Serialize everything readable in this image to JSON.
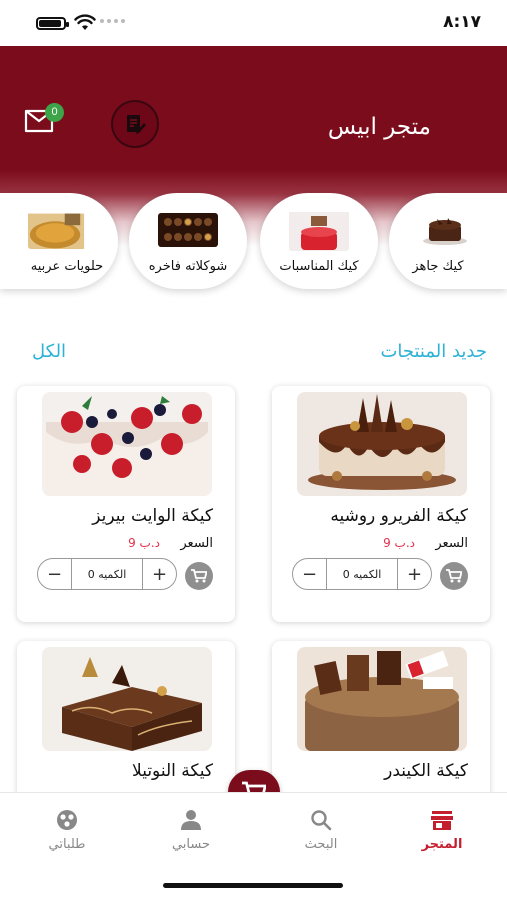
{
  "status_bar": {
    "time": "٨:١٧"
  },
  "header": {
    "store_title": "متجر ابيس",
    "cart_count": "0"
  },
  "categories": [
    {
      "label": "كيك جاهز"
    },
    {
      "label": "كيك المناسبات"
    },
    {
      "label": "شوكلاته فاخره"
    },
    {
      "label": "حلويات عربيه"
    }
  ],
  "section": {
    "title": "جديد المنتجات",
    "see_all": "الكل"
  },
  "products": [
    {
      "name": "كيكة الفريرو روشيه",
      "price_label": "السعر",
      "price": "9 د.ب",
      "qty_text": "الكميه 0"
    },
    {
      "name": "كيكة الوايت بيريز",
      "price_label": "السعر",
      "price": "9 د.ب",
      "qty_text": "الكميه 0"
    },
    {
      "name": "كيكة الكيندر"
    },
    {
      "name": "كيكة النوتيلا"
    }
  ],
  "bottom_nav": [
    {
      "label": "المتجر"
    },
    {
      "label": "البحث"
    },
    {
      "label": "حسابي"
    },
    {
      "label": "طلباتي"
    }
  ],
  "colors": {
    "brand": "#7b0c1c",
    "accent": "#2eb1d6",
    "price": "#e0304a",
    "active_nav": "#c41e2e",
    "badge": "#3ea44a"
  }
}
